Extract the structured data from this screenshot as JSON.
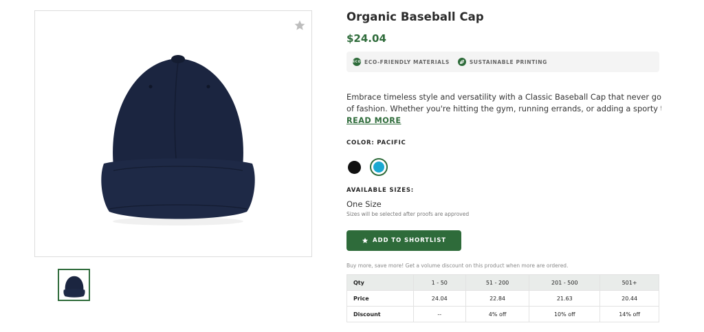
{
  "product": {
    "title": "Organic Baseball Cap",
    "price": "$24.04",
    "badges": [
      {
        "icon": "eco-icon",
        "icon_text": "ECO",
        "label": "ECO-FRIENDLY MATERIALS"
      },
      {
        "icon": "leaf-icon",
        "label": "SUSTAINABLE PRINTING"
      }
    ],
    "description_lines": [
      "Embrace timeless style and versatility with a Classic Baseball Cap that never goes out",
      "of fashion. Whether you're hitting the gym, running errands, or adding a sporty touc..."
    ],
    "read_more": "READ MORE",
    "color_label": "COLOR: PACIFIC",
    "colors": [
      {
        "name": "Black",
        "hex": "#111111"
      },
      {
        "name": "Pacific",
        "hex": "#1aa8d1",
        "selected": true
      }
    ],
    "sizes_label": "AVAILABLE SIZES:",
    "size_value": "One Size",
    "size_note": "Sizes will be selected after proofs are approved",
    "add_button": "ADD TO SHORTLIST",
    "volume_note": "Buy more, save more! Get a volume discount on this product when more are ordered."
  },
  "pricing_table": {
    "headers": [
      "Qty",
      "1 - 50",
      "51 - 200",
      "201 - 500",
      "501+"
    ],
    "rows": [
      [
        "Price",
        "24.04",
        "22.84",
        "21.63",
        "20.44"
      ],
      [
        "Discount",
        "--",
        "4% off",
        "10% off",
        "14% off"
      ]
    ]
  },
  "colors": {
    "accent": "#2e6b3a",
    "cap": "#1b2540"
  }
}
